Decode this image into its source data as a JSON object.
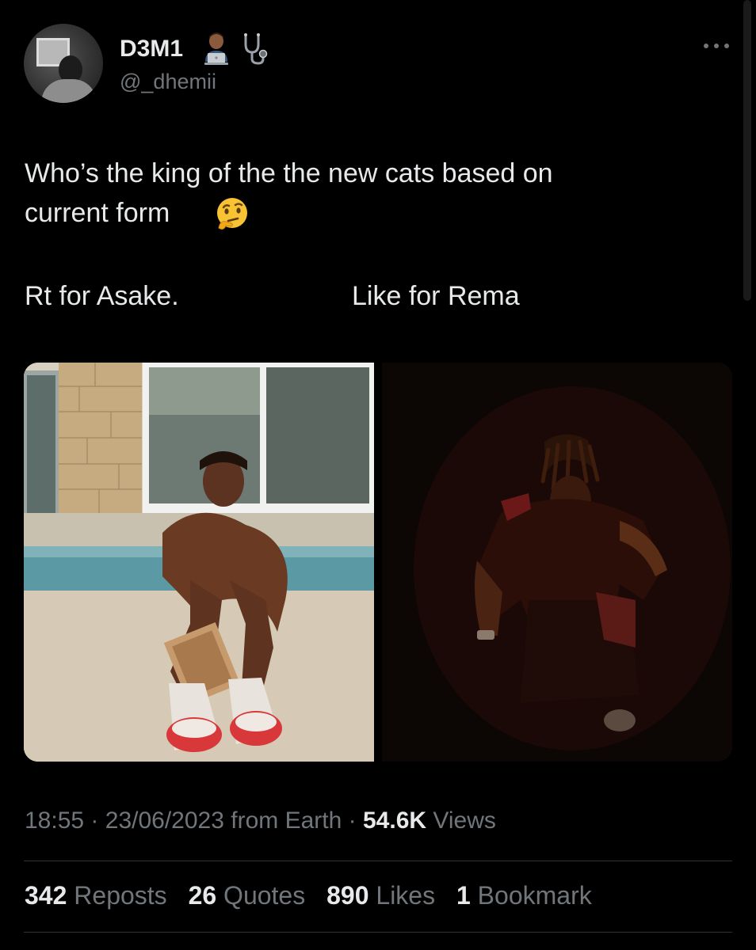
{
  "author": {
    "display_name": "D3M1",
    "handle": "@_dhemii",
    "avatar_icon": "user-avatar",
    "name_emojis": [
      "man-technologist-emoji",
      "stethoscope-emoji"
    ]
  },
  "menu_icon": "more-dots-icon",
  "tweet": {
    "line1": "Who’s the king of the the new cats based on",
    "line2": "current form",
    "emoji": "thinking-face-emoji",
    "option_rt": "Rt for Asake.",
    "option_like": "Like for Rema"
  },
  "media": {
    "left_photo": "photo-asake",
    "right_photo": "photo-rema"
  },
  "meta": {
    "time": "18:55",
    "date": "23/06/2023",
    "source": "from Earth",
    "views_count": "54.6K",
    "views_label": "Views",
    "sep": "·"
  },
  "stats": {
    "reposts_count": "342",
    "reposts_label": "Reposts",
    "quotes_count": "26",
    "quotes_label": "Quotes",
    "likes_count": "890",
    "likes_label": "Likes",
    "bookmarks_count": "1",
    "bookmarks_label": "Bookmark"
  },
  "colors": {
    "background": "#000000",
    "primary_text": "#e7e9ea",
    "secondary_text": "#71767b",
    "divider": "#2f3336"
  }
}
